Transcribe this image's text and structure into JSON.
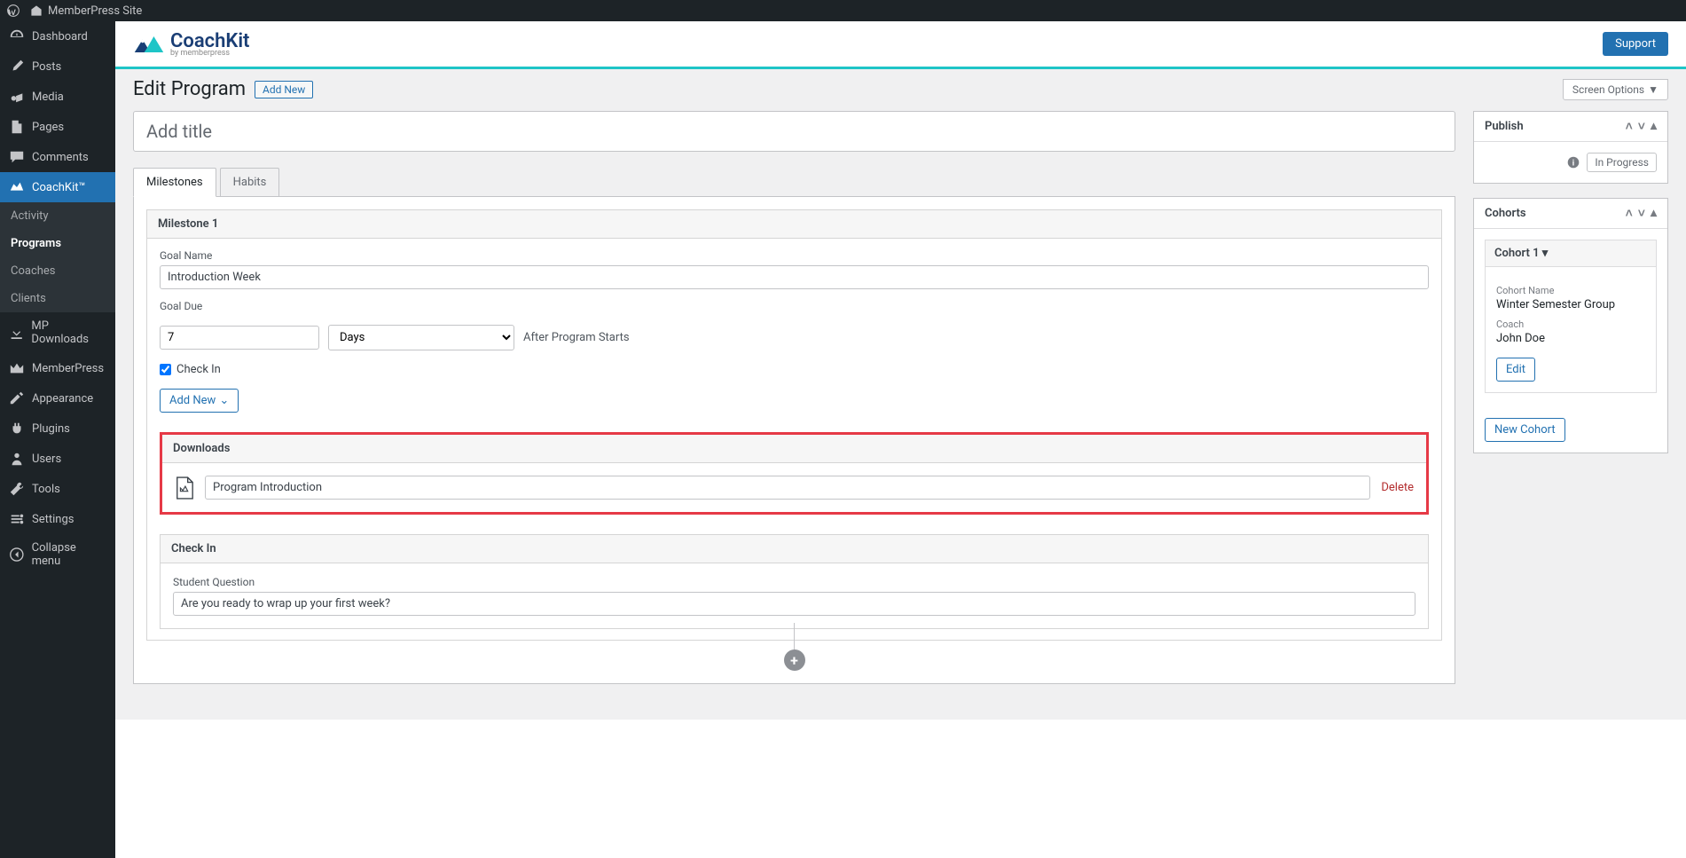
{
  "adminBar": {
    "siteName": "MemberPress Site"
  },
  "sidebar": {
    "items": [
      {
        "label": "Dashboard"
      },
      {
        "label": "Posts"
      },
      {
        "label": "Media"
      },
      {
        "label": "Pages"
      },
      {
        "label": "Comments"
      },
      {
        "label": "CoachKit™"
      }
    ],
    "sub": [
      {
        "label": "Activity"
      },
      {
        "label": "Programs"
      },
      {
        "label": "Coaches"
      },
      {
        "label": "Clients"
      }
    ],
    "items2": [
      {
        "label": "MP Downloads"
      },
      {
        "label": "MemberPress"
      },
      {
        "label": "Appearance"
      },
      {
        "label": "Plugins"
      },
      {
        "label": "Users"
      },
      {
        "label": "Tools"
      },
      {
        "label": "Settings"
      },
      {
        "label": "Collapse menu"
      }
    ]
  },
  "header": {
    "brand": "CoachKit",
    "brandSub": "by memberpress",
    "support": "Support"
  },
  "page": {
    "title": "Edit Program",
    "addNew": "Add New",
    "screenOptions": "Screen Options",
    "titlePlaceholder": "Add title"
  },
  "tabs": {
    "milestones": "Milestones",
    "habits": "Habits"
  },
  "milestone": {
    "header": "Milestone 1",
    "goalNameLabel": "Goal Name",
    "goalNameValue": "Introduction Week",
    "goalDueLabel": "Goal Due",
    "goalDueValue": "7",
    "goalDueUnit": "Days",
    "afterText": "After Program Starts",
    "checkInLabel": "Check In",
    "addNewLabel": "Add New"
  },
  "downloads": {
    "header": "Downloads",
    "fileName": "Program Introduction",
    "deleteLabel": "Delete"
  },
  "checkin": {
    "header": "Check In",
    "questionLabel": "Student Question",
    "questionValue": "Are you ready to wrap up your first week?"
  },
  "publish": {
    "title": "Publish",
    "status": "In Progress"
  },
  "cohorts": {
    "title": "Cohorts",
    "cohortHeader": "Cohort  1 ▾",
    "nameLabel": "Cohort Name",
    "nameValue": "Winter Semester Group",
    "coachLabel": "Coach",
    "coachValue": "John Doe",
    "editLabel": "Edit",
    "newCohortLabel": "New Cohort"
  }
}
